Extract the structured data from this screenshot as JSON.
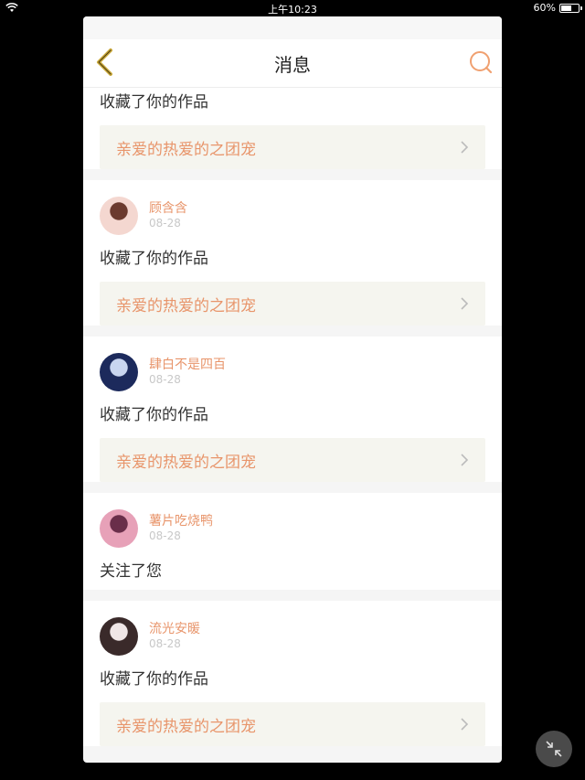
{
  "status_bar": {
    "time": "上午10:23",
    "battery": "60%",
    "battery_level": 0.6
  },
  "nav": {
    "title": "消息"
  },
  "notifications": [
    {
      "partial": true,
      "action": "收藏了你的作品",
      "work_title": "亲爱的热爱的之团宠"
    },
    {
      "username": "顾含含",
      "date": "08-28",
      "action": "收藏了你的作品",
      "work_title": "亲爱的热爱的之团宠",
      "avatar_colors": [
        "#f4d7d0",
        "#6b3a2e"
      ]
    },
    {
      "username": "肆白不是四百",
      "date": "08-28",
      "action": "收藏了你的作品",
      "work_title": "亲爱的热爱的之团宠",
      "avatar_colors": [
        "#1c2a5c",
        "#c9d6f0"
      ]
    },
    {
      "username": "薯片吃烧鸭",
      "date": "08-28",
      "action": "关注了您",
      "avatar_colors": [
        "#e7a1b8",
        "#6a2e4a"
      ]
    },
    {
      "username": "流光安暖",
      "date": "08-28",
      "action": "收藏了你的作品",
      "work_title": "亲爱的热爱的之团宠",
      "avatar_colors": [
        "#3a2a2a",
        "#f0e6e6"
      ]
    }
  ],
  "colors": {
    "accent": "#e8956b",
    "back_icon": "#caa93b",
    "search_icon": "#f0a070"
  }
}
